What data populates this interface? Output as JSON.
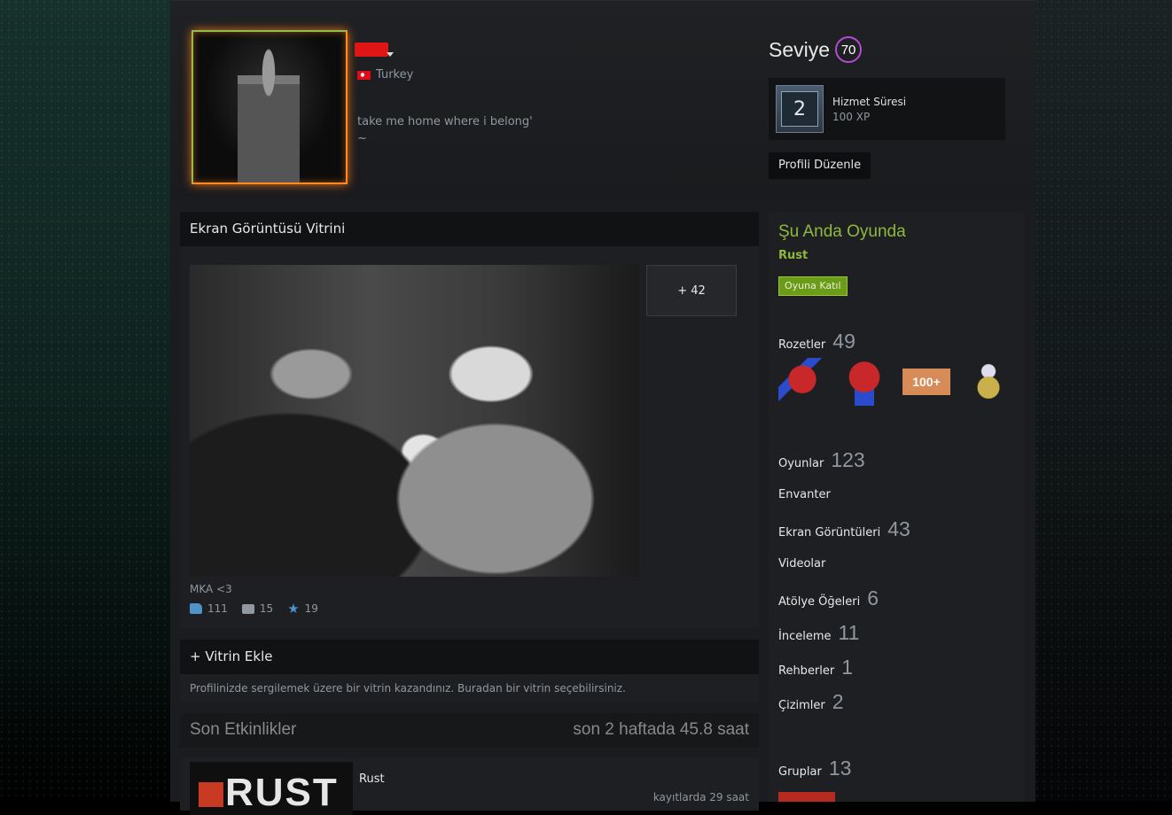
{
  "profile": {
    "country": "Turkey",
    "summary_line1": "take me home where i belong'",
    "summary_line2": "~"
  },
  "level": {
    "label": "Seviye",
    "value": "70",
    "badge_number": "2",
    "badge_name": "Hizmet Süresi",
    "badge_xp": "100 XP",
    "edit_label": "Profili Düzenle"
  },
  "showcase": {
    "title": "Ekran Görüntüsü Vitrini",
    "more_label": "+ 42",
    "caption": "MKA <3",
    "likes": "111",
    "comments": "15",
    "favorites": "19"
  },
  "add_showcase": {
    "title": "+ Vitrin Ekle",
    "text": "Profilinizde sergilemek üzere bir vitrin kazandınız. Buradan bir vitrin seçebilirsiniz."
  },
  "recent": {
    "title": "Son Etkinlikler",
    "hours": "son 2 haftada 45.8 saat",
    "game_logo": "RUST",
    "game_name": "Rust",
    "game_record": "kayıtlarda 29 saat"
  },
  "sidebar": {
    "ingame_title": "Şu Anda Oyunda",
    "ingame_game": "Rust",
    "join_label": "Oyuna Katıl",
    "badges_label": "Rozetler",
    "badges_count": "49",
    "badge3_text": "100+",
    "games_label": "Oyunlar",
    "games_count": "123",
    "inventory_label": "Envanter",
    "screenshots_label": "Ekran Görüntüleri",
    "screenshots_count": "43",
    "videos_label": "Videolar",
    "workshop_label": "Atölye Öğeleri",
    "workshop_count": "6",
    "reviews_label": "İnceleme",
    "reviews_count": "11",
    "guides_label": "Rehberler",
    "guides_count": "1",
    "artwork_label": "Çizimler",
    "artwork_count": "2",
    "groups_label": "Gruplar",
    "groups_count": "13"
  },
  "colors": {
    "ingame_green": "#8fb93b",
    "level_ring": "#b44ad6",
    "page_bg": "#1b1c1f"
  }
}
